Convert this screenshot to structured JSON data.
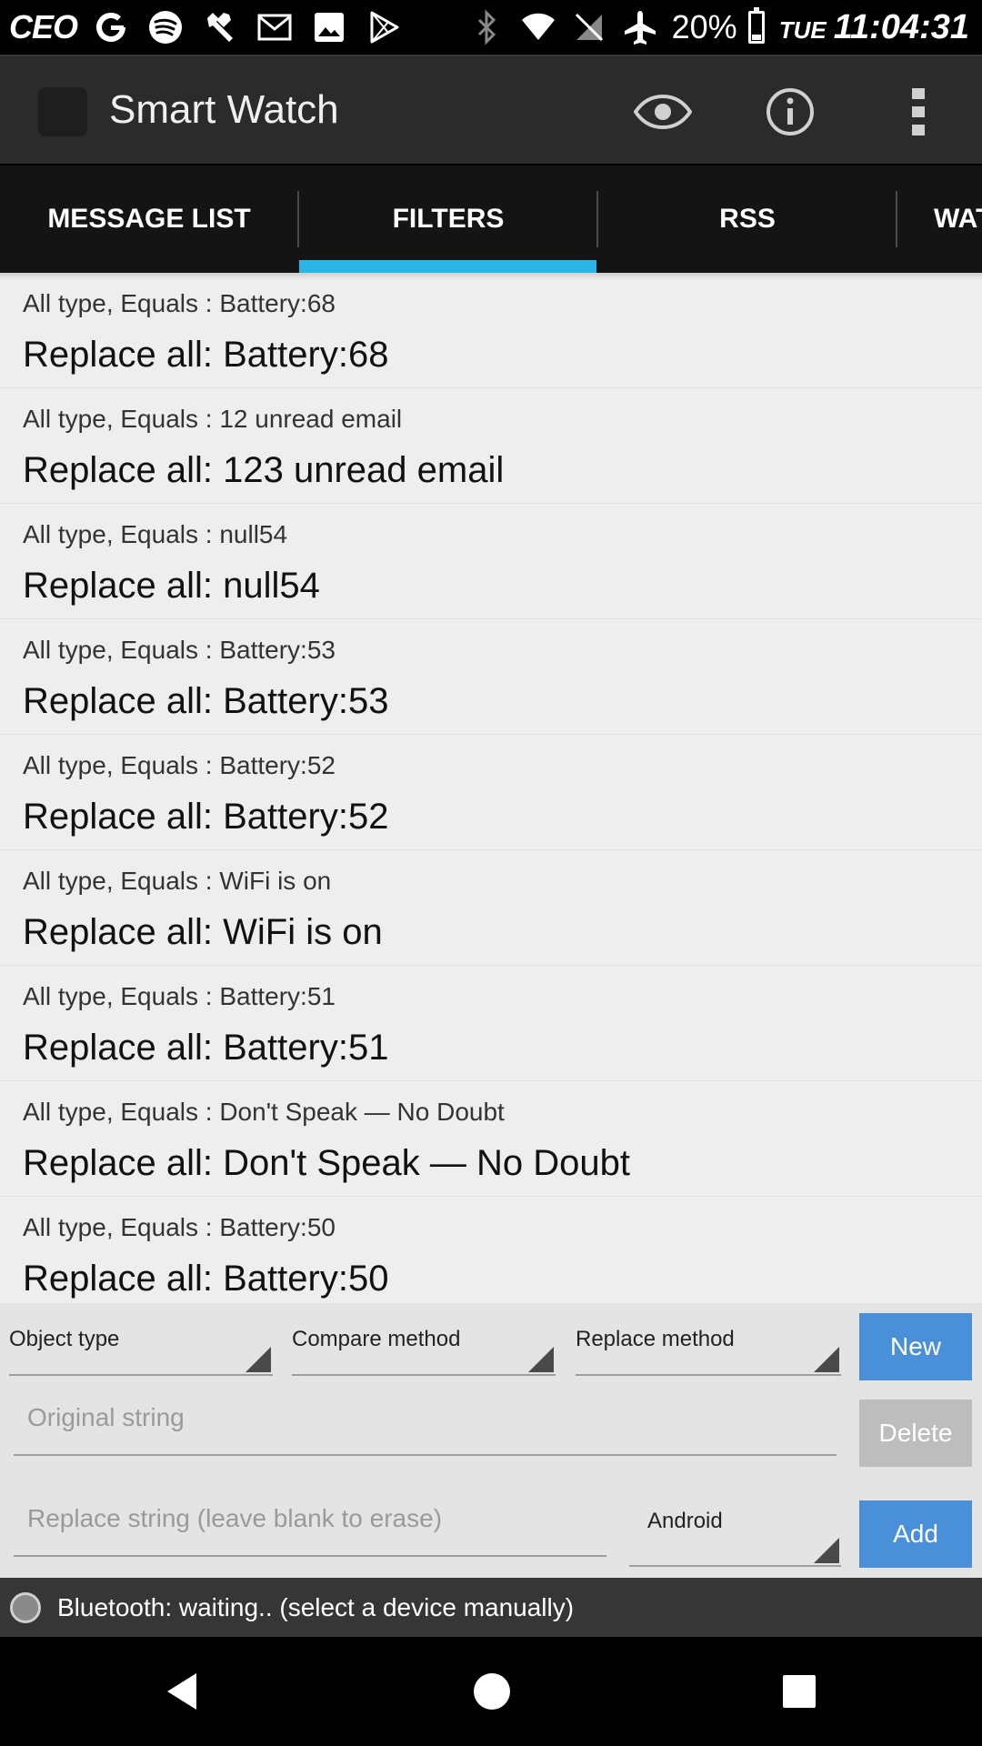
{
  "status_bar": {
    "carrier": "CEO",
    "battery_percent": "20%",
    "battery_level": 0.2,
    "day": "TUE",
    "time": "11:04:31",
    "left_icons": [
      "google-icon",
      "spotify-icon",
      "wrench-icon",
      "gmail-icon",
      "image-icon",
      "play-store-icon"
    ],
    "right_icons": [
      "bluetooth-icon",
      "wifi-icon",
      "no-sim-icon",
      "airplane-icon"
    ]
  },
  "action_bar": {
    "title": "Smart Watch",
    "icons": [
      "eye-icon",
      "info-icon",
      "overflow-menu-icon"
    ]
  },
  "tabs": [
    {
      "label": "MESSAGE LIST",
      "selected": false
    },
    {
      "label": "FILTERS",
      "selected": true
    },
    {
      "label": "RSS",
      "selected": false
    },
    {
      "label": "WAT",
      "selected": false
    }
  ],
  "accent_color": "#29b6e6",
  "filters": [
    {
      "sub": "All type, Equals : Battery:68",
      "main": "Replace all: Battery:68"
    },
    {
      "sub": "All type, Equals : 12 unread email",
      "main": "Replace all: 123 unread email"
    },
    {
      "sub": "All type, Equals : null54",
      "main": "Replace all: null54"
    },
    {
      "sub": "All type, Equals : Battery:53",
      "main": "Replace all: Battery:53"
    },
    {
      "sub": "All type, Equals : Battery:52",
      "main": "Replace all: Battery:52"
    },
    {
      "sub": "All type, Equals : WiFi is on",
      "main": "Replace all: WiFi is on"
    },
    {
      "sub": "All type, Equals : Battery:51",
      "main": "Replace all: Battery:51"
    },
    {
      "sub": "All type, Equals : Don't Speak — No Doubt",
      "main": "Replace all: Don't Speak — No Doubt"
    },
    {
      "sub": "All type, Equals : Battery:50",
      "main": "Replace all: Battery:50"
    }
  ],
  "controls": {
    "object_type": "Object type",
    "compare_method": "Compare method",
    "replace_method": "Replace method",
    "new_button": "New",
    "original_placeholder": "Original string",
    "delete_button": "Delete",
    "replace_placeholder": "Replace string (leave blank to erase)",
    "target": "Android",
    "add_button": "Add",
    "button_color": "#4a90d9"
  },
  "bluetooth": {
    "status": "Bluetooth: waiting.. (select a device manually)"
  },
  "nav_bar": {
    "icons": [
      "back-icon",
      "home-icon",
      "recents-icon"
    ]
  }
}
